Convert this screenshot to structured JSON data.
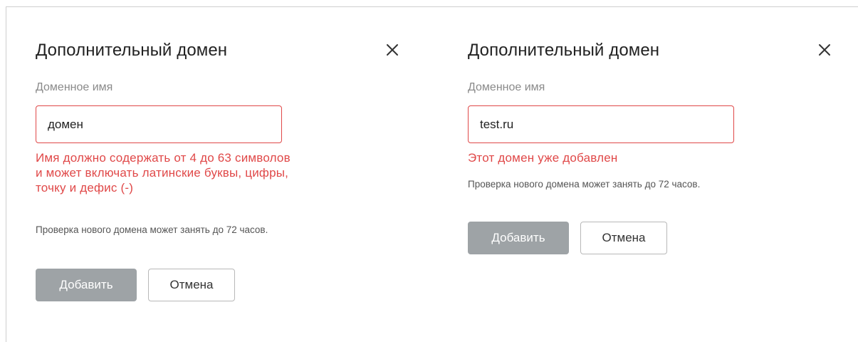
{
  "dialogs": [
    {
      "title": "Дополнительный домен",
      "field_label": "Доменное имя",
      "input_value": "домен",
      "error": "Имя должно содержать от 4 до 63 символов и может включать латинские буквы, цифры, точку и дефис (-)",
      "hint": "Проверка нового домена может занять до 72 часов.",
      "add_button": "Добавить",
      "cancel_button": "Отмена",
      "close_icon": "close-icon"
    },
    {
      "title": "Дополнительный домен",
      "field_label": "Доменное имя",
      "input_value": "test.ru",
      "error": "Этот домен уже добавлен",
      "hint": "Проверка нового домена может занять до 72 часов.",
      "add_button": "Добавить",
      "cancel_button": "Отмена",
      "close_icon": "close-icon"
    }
  ],
  "colors": {
    "error": "#e04848",
    "primary_button_disabled": "#9ea3a6",
    "label": "#8a8a8a"
  }
}
